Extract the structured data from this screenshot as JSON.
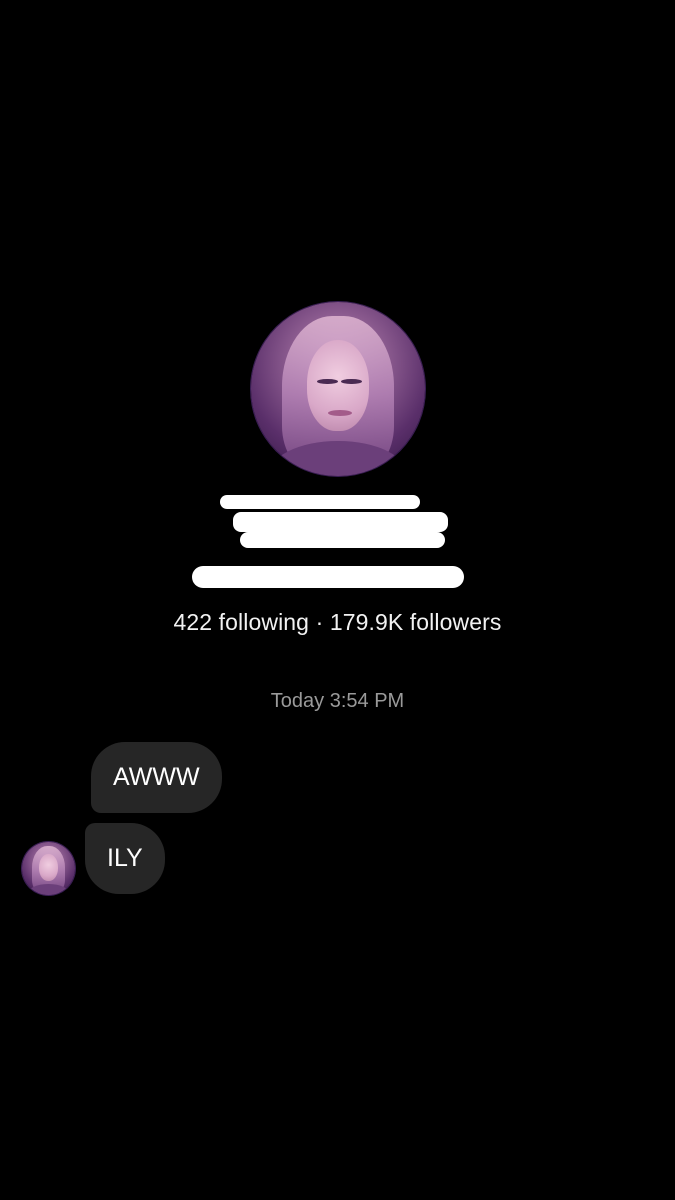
{
  "profile": {
    "avatar_icon": "profile-photo",
    "stats": "422 following · 179.9K followers"
  },
  "conversation": {
    "timestamp": "Today 3:54 PM",
    "messages": [
      {
        "text": "AWWW"
      },
      {
        "text": "ILY"
      }
    ]
  },
  "colors": {
    "background": "#000000",
    "bubble": "#262626",
    "text": "#ffffff",
    "timestamp": "#9a9a9a",
    "redaction": "#ffffff"
  }
}
